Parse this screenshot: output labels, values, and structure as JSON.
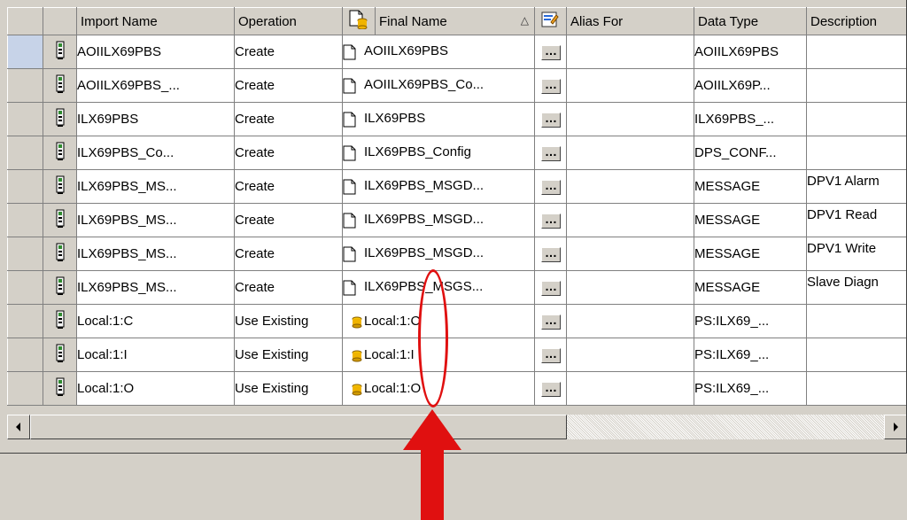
{
  "columns": {
    "import_name": "Import Name",
    "operation": "Operation",
    "final_name": "Final Name",
    "sort_indicator": "△",
    "alias_for": "Alias For",
    "data_type": "Data Type",
    "description": "Description"
  },
  "ellipsis_label": "…",
  "rows": [
    {
      "import_name": "AOIILX69PBS",
      "operation": "Create",
      "final_name": "AOIILX69PBS",
      "data_type": "AOIILX69PBS",
      "description": "",
      "final_icon": "document-icon"
    },
    {
      "import_name": "AOIILX69PBS_...",
      "operation": "Create",
      "final_name": "AOIILX69PBS_Co...",
      "data_type": "AOIILX69P...",
      "description": "",
      "final_icon": "document-icon"
    },
    {
      "import_name": "ILX69PBS",
      "operation": "Create",
      "final_name": "ILX69PBS",
      "data_type": "ILX69PBS_...",
      "description": "",
      "final_icon": "document-icon"
    },
    {
      "import_name": "ILX69PBS_Co...",
      "operation": "Create",
      "final_name": "ILX69PBS_Config",
      "data_type": "DPS_CONF...",
      "description": "",
      "final_icon": "document-icon"
    },
    {
      "import_name": "ILX69PBS_MS...",
      "operation": "Create",
      "final_name": "ILX69PBS_MSGD...",
      "data_type": "MESSAGE",
      "description": "DPV1 Alarm",
      "final_icon": "document-icon"
    },
    {
      "import_name": "ILX69PBS_MS...",
      "operation": "Create",
      "final_name": "ILX69PBS_MSGD...",
      "data_type": "MESSAGE",
      "description": "DPV1 Read",
      "final_icon": "document-icon"
    },
    {
      "import_name": "ILX69PBS_MS...",
      "operation": "Create",
      "final_name": "ILX69PBS_MSGD...",
      "data_type": "MESSAGE",
      "description": "DPV1 Write",
      "final_icon": "document-icon"
    },
    {
      "import_name": "ILX69PBS_MS...",
      "operation": "Create",
      "final_name": "ILX69PBS_MSGS...",
      "data_type": "MESSAGE",
      "description": "Slave Diagn",
      "final_icon": "document-icon"
    },
    {
      "import_name": "Local:1:C",
      "operation": "Use Existing",
      "final_name": "Local:1:C",
      "data_type": "PS:ILX69_...",
      "description": "",
      "final_icon": "database-icon"
    },
    {
      "import_name": "Local:1:I",
      "operation": "Use Existing",
      "final_name": "Local:1:I",
      "data_type": "PS:ILX69_...",
      "description": "",
      "final_icon": "database-icon"
    },
    {
      "import_name": "Local:1:O",
      "operation": "Use Existing",
      "final_name": "Local:1:O",
      "data_type": "PS:ILX69_...",
      "description": "",
      "final_icon": "database-icon"
    }
  ],
  "colors": {
    "annotation_red": "#e01010",
    "window_bg": "#d4d0c8",
    "selected_row_header": "#c7d3e8"
  }
}
